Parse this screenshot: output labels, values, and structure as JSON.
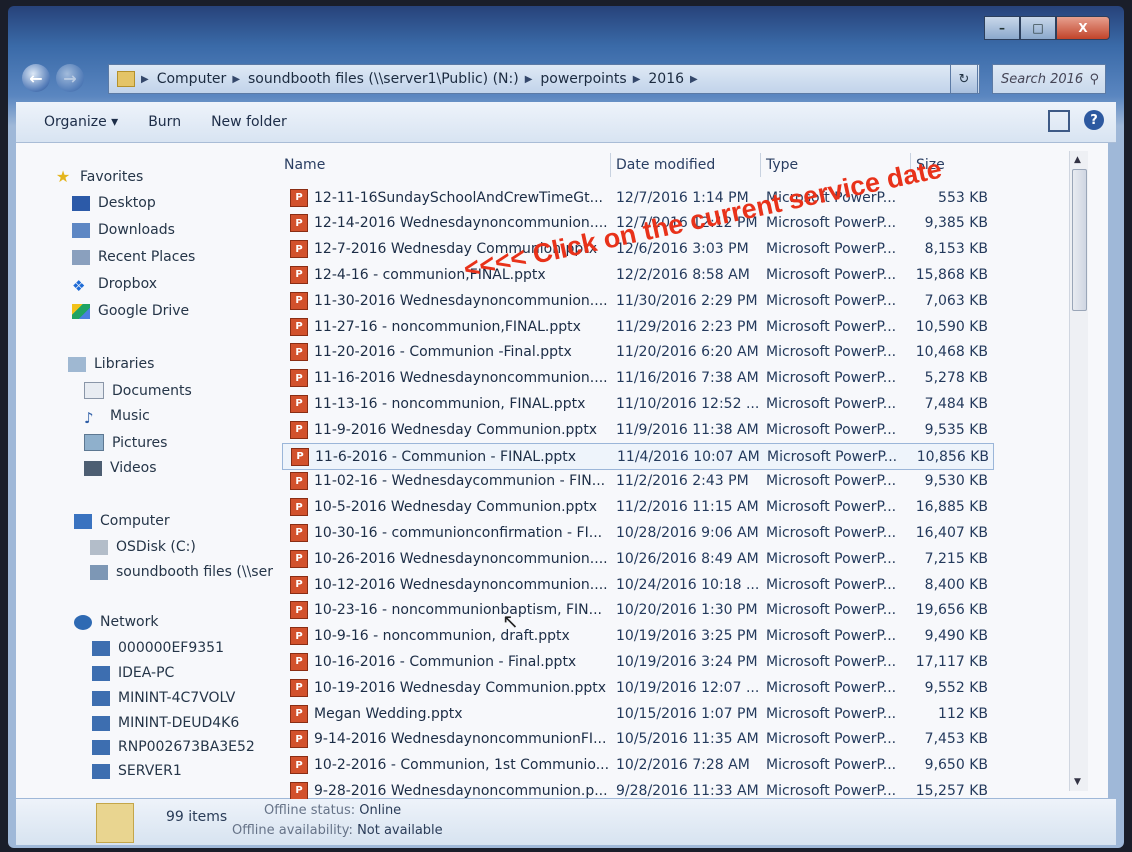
{
  "window": {
    "caption": {
      "minimize": "–",
      "maximize": "□",
      "close": "X"
    }
  },
  "address": {
    "crumbs": [
      "Computer",
      "soundbooth files (\\\\server1\\Public) (N:)",
      "powerpoints",
      "2016"
    ],
    "search_placeholder": "Search 2016"
  },
  "toolbar": {
    "organize": "Organize ▾",
    "burn": "Burn",
    "new_folder": "New folder"
  },
  "nav": {
    "favorites": "Favorites",
    "desktop": "Desktop",
    "downloads": "Downloads",
    "recent": "Recent Places",
    "dropbox": "Dropbox",
    "gdrive": "Google Drive",
    "libraries": "Libraries",
    "documents": "Documents",
    "music": "Music",
    "pictures": "Pictures",
    "videos": "Videos",
    "computer": "Computer",
    "osdisk": "OSDisk (C:)",
    "soundbooth": "soundbooth files (\\\\ser",
    "network": "Network",
    "net1": "000000EF9351",
    "net2": "IDEA-PC",
    "net3": "MININT-4C7VOLV",
    "net4": "MININT-DEUD4K6",
    "net5": "RNP002673BA3E52",
    "net6": "SERVER1"
  },
  "headers": {
    "name": "Name",
    "date": "Date modified",
    "type": "Type",
    "size": "Size"
  },
  "files": [
    {
      "name": "12-11-16SundaySchoolAndCrewTimeGt...",
      "date": "12/7/2016 1:14 PM",
      "type": "Microsoft PowerP...",
      "size": "553 KB"
    },
    {
      "name": "12-14-2016 Wednesdaynoncommunion....",
      "date": "12/7/2016 12:12 PM",
      "type": "Microsoft PowerP...",
      "size": "9,385 KB"
    },
    {
      "name": "12-7-2016 Wednesday Communion.pptx",
      "date": "12/6/2016 3:03 PM",
      "type": "Microsoft PowerP...",
      "size": "8,153 KB"
    },
    {
      "name": "12-4-16 - communion,FINAL.pptx",
      "date": "12/2/2016 8:58 AM",
      "type": "Microsoft PowerP...",
      "size": "15,868 KB"
    },
    {
      "name": "11-30-2016 Wednesdaynoncommunion....",
      "date": "11/30/2016 2:29 PM",
      "type": "Microsoft PowerP...",
      "size": "7,063 KB"
    },
    {
      "name": "11-27-16 - noncommunion,FINAL.pptx",
      "date": "11/29/2016 2:23 PM",
      "type": "Microsoft PowerP...",
      "size": "10,590 KB"
    },
    {
      "name": "11-20-2016 - Communion -Final.pptx",
      "date": "11/20/2016 6:20 AM",
      "type": "Microsoft PowerP...",
      "size": "10,468 KB"
    },
    {
      "name": "11-16-2016 Wednesdaynoncommunion....",
      "date": "11/16/2016 7:38 AM",
      "type": "Microsoft PowerP...",
      "size": "5,278 KB"
    },
    {
      "name": "11-13-16 - noncommunion, FINAL.pptx",
      "date": "11/10/2016 12:52 ...",
      "type": "Microsoft PowerP...",
      "size": "7,484 KB"
    },
    {
      "name": "11-9-2016 Wednesday Communion.pptx",
      "date": "11/9/2016 11:38 AM",
      "type": "Microsoft PowerP...",
      "size": "9,535 KB"
    },
    {
      "name": "11-6-2016 - Communion - FINAL.pptx",
      "date": "11/4/2016 10:07 AM",
      "type": "Microsoft PowerP...",
      "size": "10,856 KB"
    },
    {
      "name": "11-02-16 - Wednesdaycommunion - FIN...",
      "date": "11/2/2016 2:43 PM",
      "type": "Microsoft PowerP...",
      "size": "9,530 KB"
    },
    {
      "name": "10-5-2016 Wednesday Communion.pptx",
      "date": "11/2/2016 11:15 AM",
      "type": "Microsoft PowerP...",
      "size": "16,885 KB"
    },
    {
      "name": "10-30-16 - communionconfirmation - FI...",
      "date": "10/28/2016 9:06 AM",
      "type": "Microsoft PowerP...",
      "size": "16,407 KB"
    },
    {
      "name": "10-26-2016 Wednesdaynoncommunion....",
      "date": "10/26/2016 8:49 AM",
      "type": "Microsoft PowerP...",
      "size": "7,215 KB"
    },
    {
      "name": "10-12-2016 Wednesdaynoncommunion....",
      "date": "10/24/2016 10:18 ...",
      "type": "Microsoft PowerP...",
      "size": "8,400 KB"
    },
    {
      "name": "10-23-16 - noncommunionbaptism, FIN...",
      "date": "10/20/2016 1:30 PM",
      "type": "Microsoft PowerP...",
      "size": "19,656 KB"
    },
    {
      "name": "10-9-16 - noncommunion, draft.pptx",
      "date": "10/19/2016 3:25 PM",
      "type": "Microsoft PowerP...",
      "size": "9,490 KB"
    },
    {
      "name": "10-16-2016 - Communion - Final.pptx",
      "date": "10/19/2016 3:24 PM",
      "type": "Microsoft PowerP...",
      "size": "17,117 KB"
    },
    {
      "name": "10-19-2016 Wednesday Communion.pptx",
      "date": "10/19/2016 12:07 ...",
      "type": "Microsoft PowerP...",
      "size": "9,552 KB"
    },
    {
      "name": "Megan Wedding.pptx",
      "date": "10/15/2016 1:07 PM",
      "type": "Microsoft PowerP...",
      "size": "112 KB"
    },
    {
      "name": "9-14-2016 WednesdaynoncommunionFI...",
      "date": "10/5/2016 11:35 AM",
      "type": "Microsoft PowerP...",
      "size": "7,453 KB"
    },
    {
      "name": "10-2-2016 - Communion, 1st Communio...",
      "date": "10/2/2016 7:28 AM",
      "type": "Microsoft PowerP...",
      "size": "9,650 KB"
    },
    {
      "name": "9-28-2016 Wednesdaynoncommunion.p...",
      "date": "9/28/2016 11:33 AM",
      "type": "Microsoft PowerP...",
      "size": "15,257 KB"
    }
  ],
  "annotation": "<<<< Click on the current service date",
  "status": {
    "count": "99 items",
    "offline_status_label": "Offline status:",
    "offline_status_value": "Online",
    "offline_avail_label": "Offline availability:",
    "offline_avail_value": "Not available"
  }
}
